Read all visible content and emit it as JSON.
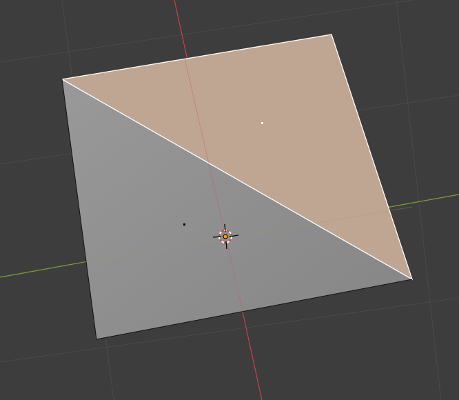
{
  "viewport": {
    "background_color": "#3d3d3d",
    "grid_color": "#4a4a4a",
    "x_axis_color": "#7ea131",
    "y_axis_color": "#c4424f",
    "face_unselected_color": "#8e8e8e",
    "face_selected_color": "#bfa693",
    "edge_selected_color": "#ffffff",
    "edge_color": "#111111",
    "face_dot_selected_color": "#ffffff",
    "face_dot_color": "#000000",
    "origin_color": "#ff9a1a",
    "cursor_ring_colors": [
      "#ffffff",
      "#e0403a"
    ],
    "cursor_cross_color": "#000000"
  },
  "mesh": {
    "faces": [
      {
        "id": "face-lower-left",
        "selected": false
      },
      {
        "id": "face-upper-right",
        "selected": true
      }
    ]
  },
  "icons": {
    "cursor": "3d-cursor-icon",
    "origin": "object-origin-icon"
  }
}
